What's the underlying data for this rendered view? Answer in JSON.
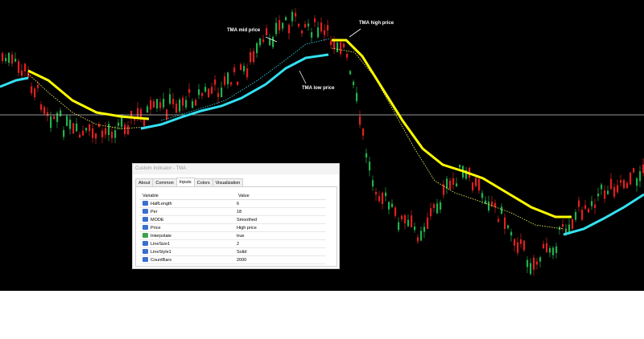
{
  "annotations": {
    "mid": "TMA mid price",
    "high": "TMA high price",
    "low": "TMA low price"
  },
  "colors": {
    "background": "#000000",
    "up_candle": "#22b14c",
    "down_candle": "#e02020",
    "tma_high": "#ffff00",
    "tma_low": "#33e0f0",
    "tma_mid": "#ffff66",
    "crosshair": "#c8c8c8"
  },
  "dialog": {
    "title": "Custom Indicator - TMA",
    "tabs": [
      "About",
      "Common",
      "Inputs",
      "Colors",
      "Visualization"
    ],
    "active_tab": "Inputs",
    "columns": {
      "variable": "Variable",
      "value": "Value"
    },
    "rows": [
      {
        "variable": "HalfLength",
        "value": "6",
        "icon": "number-param-icon"
      },
      {
        "variable": "Per",
        "value": "18",
        "icon": "number-param-icon"
      },
      {
        "variable": "MODE",
        "value": "Smoothed",
        "icon": "enum-param-icon"
      },
      {
        "variable": "Price",
        "value": "High price",
        "icon": "enum-param-icon"
      },
      {
        "variable": "Interpolate",
        "value": "true",
        "icon": "bool-param-icon"
      },
      {
        "variable": "LineSize1",
        "value": "2",
        "icon": "number-param-icon"
      },
      {
        "variable": "LineStyle1",
        "value": "Solid",
        "icon": "enum-param-icon"
      },
      {
        "variable": "CountBars",
        "value": "2000",
        "icon": "number-param-icon"
      }
    ]
  }
}
